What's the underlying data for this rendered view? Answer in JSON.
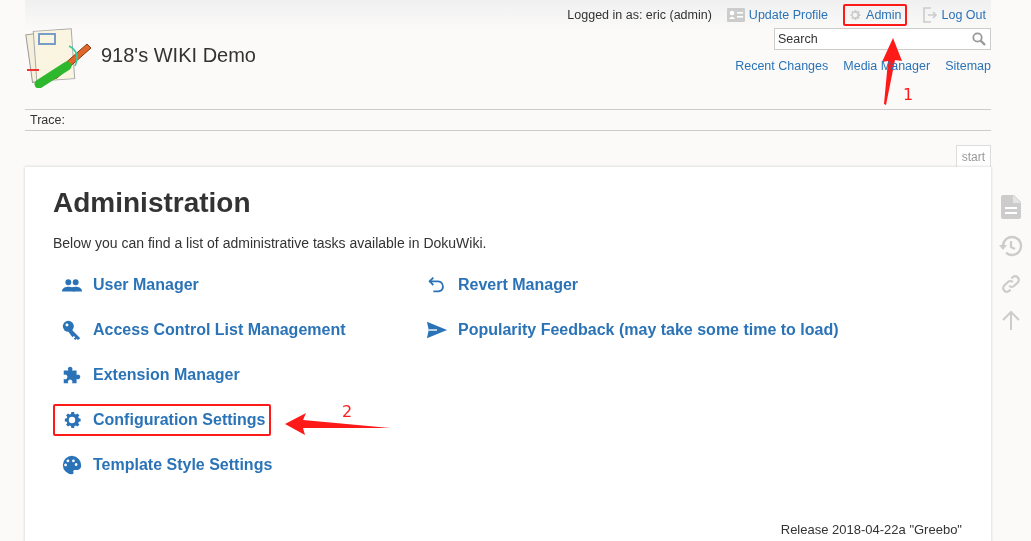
{
  "site": {
    "title": "918's WIKI Demo"
  },
  "user_bar": {
    "logged_in": "Logged in as: eric (admin)",
    "links": [
      {
        "kind": "profile",
        "label": "Update Profile",
        "highlighted": false
      },
      {
        "kind": "admin",
        "label": "Admin",
        "highlighted": true
      },
      {
        "kind": "logout",
        "label": "Log Out",
        "highlighted": false
      }
    ]
  },
  "search": {
    "placeholder": "Search"
  },
  "site_nav": [
    "Recent Changes",
    "Media Manager",
    "Sitemap"
  ],
  "trace": {
    "label": "Trace:"
  },
  "page_tab": "start",
  "page": {
    "heading": "Administration",
    "intro": "Below you can find a list of administrative tasks available in DokuWiki.",
    "tasks_left": [
      {
        "kind": "users",
        "label": "User Manager",
        "highlighted": false
      },
      {
        "kind": "key",
        "label": "Access Control List Management",
        "highlighted": false
      },
      {
        "kind": "puzzle",
        "label": "Extension Manager",
        "highlighted": false
      },
      {
        "kind": "gear",
        "label": "Configuration Settings",
        "highlighted": true
      },
      {
        "kind": "palette",
        "label": "Template Style Settings",
        "highlighted": false
      }
    ],
    "tasks_right": [
      {
        "kind": "revert",
        "label": "Revert Manager",
        "highlighted": false
      },
      {
        "kind": "send",
        "label": "Popularity Feedback (may take some time to load)",
        "highlighted": false
      }
    ],
    "footer": "Release 2018-04-22a \"Greebo\""
  },
  "page_tools": [
    {
      "kind": "document"
    },
    {
      "kind": "history"
    },
    {
      "kind": "link"
    },
    {
      "kind": "top"
    }
  ],
  "annotations": [
    {
      "number": "1"
    },
    {
      "number": "2"
    }
  ]
}
